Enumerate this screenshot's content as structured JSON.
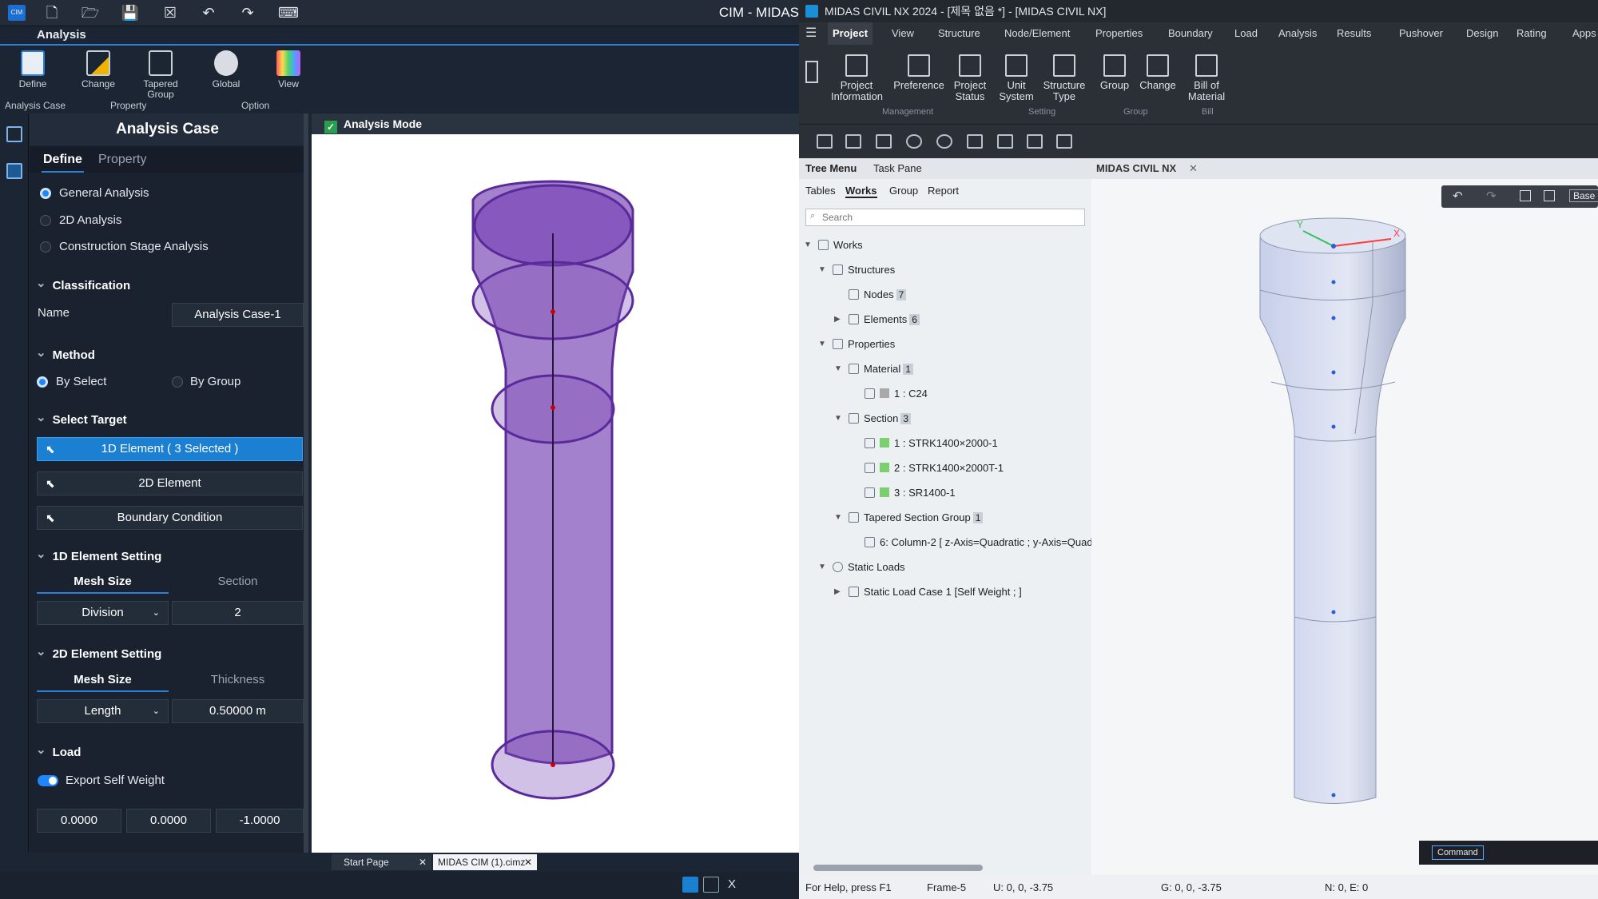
{
  "left": {
    "window_title": "CIM - MIDAS",
    "ribbon_tab": "Analysis",
    "ribbon": {
      "define": "Define",
      "change": "Change",
      "tapered_group": "Tapered Group",
      "global": "Global",
      "view": "View",
      "group_analysis_case": "Analysis Case",
      "group_property": "Property",
      "group_option": "Option"
    },
    "viewport_header": "Analysis Mode",
    "panel": {
      "title": "Analysis Case",
      "tab_define": "Define",
      "tab_property": "Property",
      "analysis_types": [
        "General Analysis",
        "2D Analysis",
        "Construction Stage Analysis"
      ],
      "classification": "Classification",
      "name_label": "Name",
      "name_value": "Analysis Case-1",
      "method": "Method",
      "by_select": "By Select",
      "by_group": "By Group",
      "select_target": "Select Target",
      "target_1d": "1D Element ( 3 Selected )",
      "target_2d": "2D Element",
      "target_bc": "Boundary Condition",
      "setting_1d": "1D Element Setting",
      "mesh_size": "Mesh Size",
      "section": "Section",
      "division": "Division",
      "division_value": "2",
      "setting_2d": "2D Element Setting",
      "thickness": "Thickness",
      "length": "Length",
      "length_value": "0.50000 m",
      "load": "Load",
      "export_self_weight": "Export Self Weight",
      "gravity": [
        "0.0000",
        "0.0000",
        "-1.0000"
      ]
    },
    "bottom_tabs": [
      "Start Page",
      "MIDAS CIM (1).cimz"
    ],
    "bottom_tool_x": "X"
  },
  "right": {
    "window_title": "MIDAS CIVIL NX 2024 - [제목 없음 *] - [MIDAS CIVIL NX]",
    "menu": [
      "Project",
      "View",
      "Structure",
      "Node/Element",
      "Properties",
      "Boundary",
      "Load",
      "Analysis",
      "Results",
      "Pushover",
      "Design",
      "Rating",
      "Apps"
    ],
    "ribbon": [
      {
        "label": "Project Information"
      },
      {
        "label": "Preference"
      },
      {
        "label": "Project Status"
      },
      {
        "label": "Unit System"
      },
      {
        "label": "Structure Type"
      },
      {
        "label": "Group"
      },
      {
        "label": "Change"
      },
      {
        "label": "Bill of Material"
      }
    ],
    "ribbon_groups": [
      "Management",
      "Setting",
      "Group",
      "Bill"
    ],
    "tree": {
      "top_tabs": [
        "Tree Menu",
        "Task Pane"
      ],
      "sub_tabs": [
        "Tables",
        "Works",
        "Group",
        "Report"
      ],
      "search_placeholder": "Search",
      "works": "Works",
      "structures": "Structures",
      "nodes": "Nodes",
      "nodes_count": "7",
      "elements": "Elements",
      "elements_count": "6",
      "properties": "Properties",
      "material": "Material",
      "material_count": "1",
      "material_item": "1 : C24",
      "section": "Section",
      "section_count": "3",
      "sections": [
        "1 : STRK1400×2000-1",
        "2 : STRK1400×2000T-1",
        "3 : SR1400-1"
      ],
      "tapered_group": "Tapered Section Group",
      "tapered_count": "1",
      "tapered_item": "6: Column-2 [ z-Axis=Quadratic ; y-Axis=Quad",
      "static_loads": "Static Loads",
      "static_load_case": "Static Load Case 1 [Self Weight ; ]"
    },
    "view_tab": "MIDAS CIVIL NX",
    "view_base": "Base",
    "command": "Command",
    "axis_y": "Y",
    "axis_x": "X",
    "status": {
      "help": "For Help, press F1",
      "frame": "Frame-5",
      "u": "U: 0, 0, -3.75",
      "g": "G: 0, 0, -3.75",
      "ne": "N: 0, E: 0"
    }
  },
  "colors": {
    "accent": "#1b7fd2",
    "purple_model": "#6b3fa0",
    "green_section": "#7ccf6e"
  }
}
